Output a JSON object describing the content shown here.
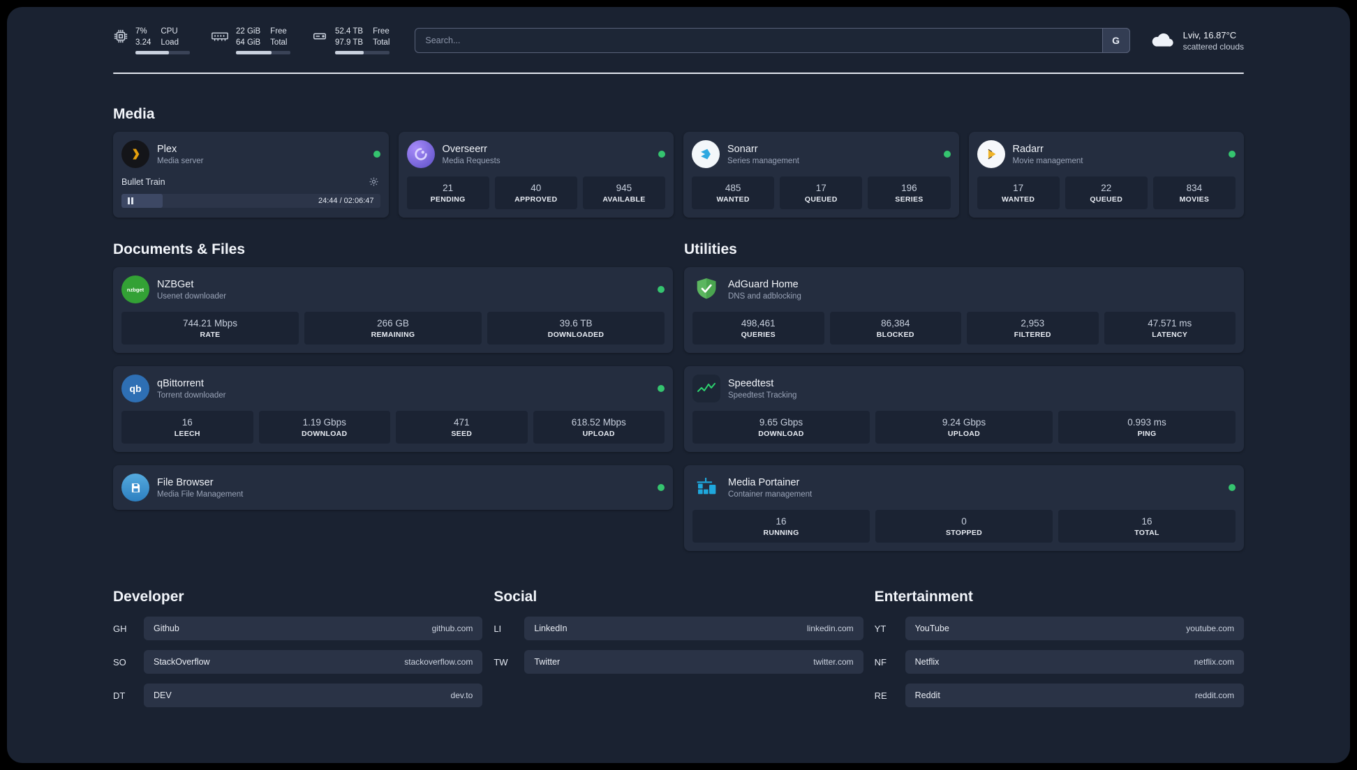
{
  "topbar": {
    "cpu": {
      "value1": "7%",
      "value2": "3.24",
      "label1": "CPU",
      "label2": "Load",
      "bar": 62
    },
    "ram": {
      "value1": "22 GiB",
      "value2": "64 GiB",
      "label1": "Free",
      "label2": "Total",
      "bar": 66
    },
    "disk": {
      "value1": "52.4 TB",
      "value2": "97.9 TB",
      "label1": "Free",
      "label2": "Total",
      "bar": 53
    },
    "search": {
      "placeholder": "Search...",
      "engine_button": "G"
    },
    "weather": {
      "location": "Lviv, 16.87°C",
      "condition": "scattered clouds"
    }
  },
  "media": {
    "title": "Media",
    "plex": {
      "name": "Plex",
      "subtitle": "Media server",
      "now_playing": "Bullet Train",
      "time": "24:44 / 02:06:47",
      "progress": 16
    },
    "overseerr": {
      "name": "Overseerr",
      "subtitle": "Media Requests",
      "stats": [
        {
          "value": "21",
          "label": "PENDING"
        },
        {
          "value": "40",
          "label": "APPROVED"
        },
        {
          "value": "945",
          "label": "AVAILABLE"
        }
      ]
    },
    "sonarr": {
      "name": "Sonarr",
      "subtitle": "Series management",
      "stats": [
        {
          "value": "485",
          "label": "WANTED"
        },
        {
          "value": "17",
          "label": "QUEUED"
        },
        {
          "value": "196",
          "label": "SERIES"
        }
      ]
    },
    "radarr": {
      "name": "Radarr",
      "subtitle": "Movie management",
      "stats": [
        {
          "value": "17",
          "label": "WANTED"
        },
        {
          "value": "22",
          "label": "QUEUED"
        },
        {
          "value": "834",
          "label": "MOVIES"
        }
      ]
    }
  },
  "documents": {
    "title": "Documents & Files",
    "nzbget": {
      "name": "NZBGet",
      "subtitle": "Usenet downloader",
      "stats": [
        {
          "value": "744.21 Mbps",
          "label": "RATE"
        },
        {
          "value": "266 GB",
          "label": "REMAINING"
        },
        {
          "value": "39.6 TB",
          "label": "DOWNLOADED"
        }
      ]
    },
    "qbittorrent": {
      "name": "qBittorrent",
      "subtitle": "Torrent downloader",
      "stats": [
        {
          "value": "16",
          "label": "LEECH"
        },
        {
          "value": "1.19 Gbps",
          "label": "DOWNLOAD"
        },
        {
          "value": "471",
          "label": "SEED"
        },
        {
          "value": "618.52 Mbps",
          "label": "UPLOAD"
        }
      ]
    },
    "filebrowser": {
      "name": "File Browser",
      "subtitle": "Media File Management"
    }
  },
  "utilities": {
    "title": "Utilities",
    "adguard": {
      "name": "AdGuard Home",
      "subtitle": "DNS and adblocking",
      "stats": [
        {
          "value": "498,461",
          "label": "QUERIES"
        },
        {
          "value": "86,384",
          "label": "BLOCKED"
        },
        {
          "value": "2,953",
          "label": "FILTERED"
        },
        {
          "value": "47.571 ms",
          "label": "LATENCY"
        }
      ]
    },
    "speedtest": {
      "name": "Speedtest",
      "subtitle": "Speedtest Tracking",
      "stats": [
        {
          "value": "9.65 Gbps",
          "label": "DOWNLOAD"
        },
        {
          "value": "9.24 Gbps",
          "label": "UPLOAD"
        },
        {
          "value": "0.993 ms",
          "label": "PING"
        }
      ]
    },
    "portainer": {
      "name": "Media Portainer",
      "subtitle": "Container management",
      "stats": [
        {
          "value": "16",
          "label": "RUNNING"
        },
        {
          "value": "0",
          "label": "STOPPED"
        },
        {
          "value": "16",
          "label": "TOTAL"
        }
      ]
    }
  },
  "bookmarks": {
    "developer": {
      "title": "Developer",
      "items": [
        {
          "abbr": "GH",
          "name": "Github",
          "url": "github.com"
        },
        {
          "abbr": "SO",
          "name": "StackOverflow",
          "url": "stackoverflow.com"
        },
        {
          "abbr": "DT",
          "name": "DEV",
          "url": "dev.to"
        }
      ]
    },
    "social": {
      "title": "Social",
      "items": [
        {
          "abbr": "LI",
          "name": "LinkedIn",
          "url": "linkedin.com"
        },
        {
          "abbr": "TW",
          "name": "Twitter",
          "url": "twitter.com"
        }
      ]
    },
    "entertainment": {
      "title": "Entertainment",
      "items": [
        {
          "abbr": "YT",
          "name": "YouTube",
          "url": "youtube.com"
        },
        {
          "abbr": "NF",
          "name": "Netflix",
          "url": "netflix.com"
        },
        {
          "abbr": "RE",
          "name": "Reddit",
          "url": "reddit.com"
        }
      ]
    }
  },
  "colors": {
    "status_online": "#35c46f",
    "accent_green": "#2dd36f",
    "panel_bg": "#1a2231",
    "card_bg": "#242d3f"
  }
}
